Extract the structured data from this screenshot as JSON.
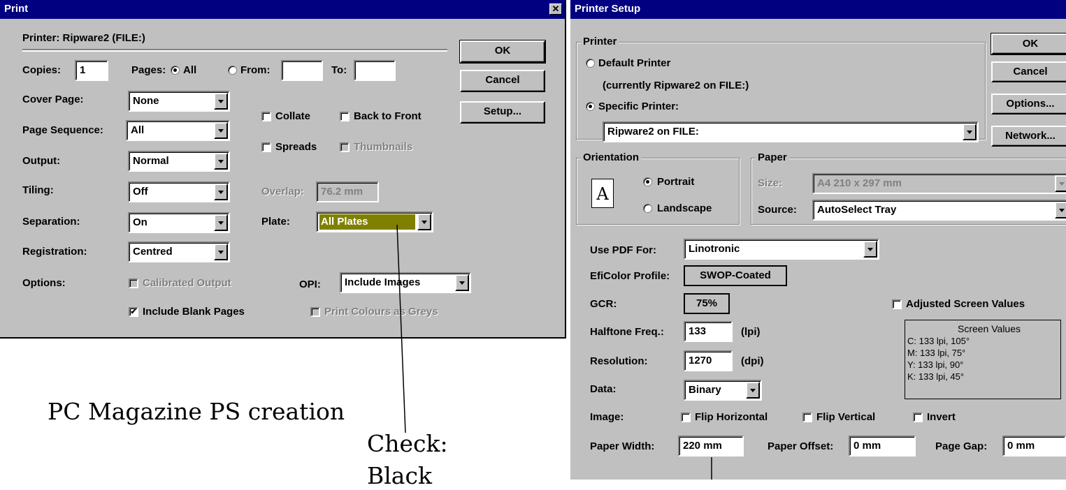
{
  "print": {
    "title": "Print",
    "close_glyph": "✕",
    "printer_label": "Printer:  Ripware2  (FILE:)",
    "ok": "OK",
    "cancel": "Cancel",
    "setup": "Setup...",
    "copies_label": "Copies:",
    "copies_value": "1",
    "pages_label": "Pages:",
    "all_label": "All",
    "from_label": "From:",
    "to_label": "To:",
    "from_value": "",
    "to_value": "",
    "cover_label": "Cover Page:",
    "cover_value": "None",
    "sequence_label": "Page Sequence:",
    "sequence_value": "All",
    "output_label": "Output:",
    "output_value": "Normal",
    "tiling_label": "Tiling:",
    "tiling_value": "Off",
    "separation_label": "Separation:",
    "separation_value": "On",
    "registration_label": "Registration:",
    "registration_value": "Centred",
    "options_label": "Options:",
    "collate": "Collate",
    "back_to_front": "Back to Front",
    "spreads": "Spreads",
    "thumbnails": "Thumbnails",
    "overlap_label": "Overlap:",
    "overlap_value": "76.2 mm",
    "plate_label": "Plate:",
    "plate_value": "All Plates",
    "calibrated": "Calibrated Output",
    "opi_label": "OPI:",
    "opi_value": "Include Images",
    "include_blank": "Include Blank Pages",
    "include_blank_mark": "✔",
    "print_greys": "Print Colours as Greys"
  },
  "setup": {
    "title": "Printer Setup",
    "printer_group": "Printer",
    "default_printer": "Default Printer",
    "currently": "(currently Ripware2 on FILE:)",
    "specific_printer": "Specific Printer:",
    "printer_value": "Ripware2 on FILE:",
    "ok": "OK",
    "cancel": "Cancel",
    "options": "Options...",
    "network": "Network...",
    "orientation_group": "Orientation",
    "portrait": "Portrait",
    "landscape": "Landscape",
    "orientation_icon_letter": "A",
    "paper_group": "Paper",
    "size_label": "Size:",
    "size_value": "A4 210 x 297 mm",
    "source_label": "Source:",
    "source_value": "AutoSelect Tray",
    "use_pdf_label": "Use PDF For:",
    "use_pdf_value": "Linotronic",
    "eficolor_label": "EfiColor Profile:",
    "eficolor_value": "SWOP-Coated",
    "gcr_label": "GCR:",
    "gcr_value": "75%",
    "adjusted_screen": "Adjusted Screen Values",
    "halftone_label": "Halftone Freq.:",
    "halftone_value": "133",
    "lpi": "(lpi)",
    "resolution_label": "Resolution:",
    "resolution_value": "1270",
    "dpi": "(dpi)",
    "data_label": "Data:",
    "data_value": "Binary",
    "screen_values_title": "Screen Values",
    "screen_values": [
      "C: 133 lpi, 105°",
      "M: 133 lpi, 75°",
      "Y: 133 lpi, 90°",
      "K: 133 lpi, 45°"
    ],
    "image_label": "Image:",
    "flip_h": "Flip Horizontal",
    "flip_v": "Flip Vertical",
    "invert": "Invert",
    "paper_width_label": "Paper Width:",
    "paper_width_value": "220 mm",
    "paper_offset_label": "Paper Offset:",
    "paper_offset_value": "0 mm",
    "page_gap_label": "Page Gap:",
    "page_gap_value": "0 mm"
  },
  "annotations": {
    "caption": "PC Magazine PS creation",
    "check_line1": "Check:",
    "check_line2": "Black"
  }
}
